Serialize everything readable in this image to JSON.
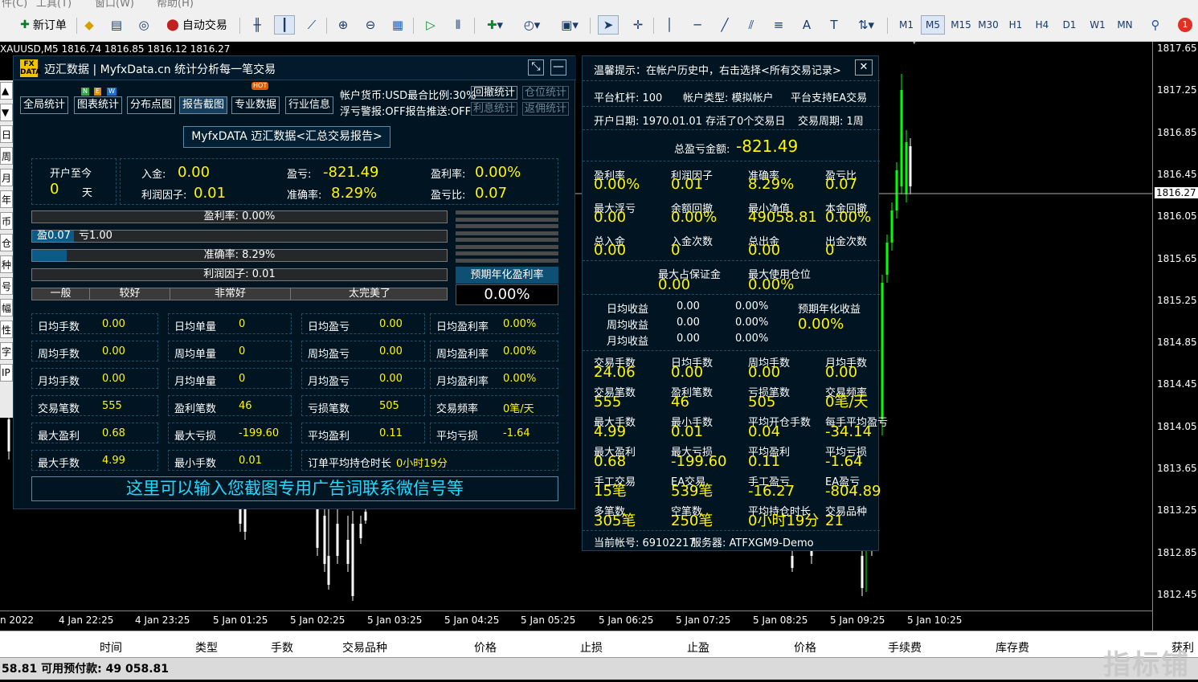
{
  "menu": {
    "items": [
      "件(C)",
      "工具(T)",
      "窗口(W)",
      "帮助(H)"
    ]
  },
  "toolbar": {
    "new_order": "新订单",
    "auto_trade": "自动交易",
    "periods": [
      "M1",
      "M5",
      "M15",
      "M30",
      "H1",
      "H4",
      "D1",
      "W1",
      "MN"
    ],
    "active_period": "M5",
    "notification_count": "1",
    "text_tool": "A"
  },
  "chart": {
    "symbol_line": "XAUUSD,M5  1816.74 1816.85 1816.12 1816.27",
    "current_price": "1816.27",
    "price_ticks": [
      "1817.65",
      "1817.25",
      "1816.85",
      "1816.45",
      "1816.05",
      "1815.65",
      "1815.25",
      "1814.85",
      "1814.45",
      "1814.05",
      "1813.65",
      "1813.25",
      "1812.85",
      "1812.45"
    ],
    "time_ticks": [
      "n 2022",
      "4 Jan 22:25",
      "4 Jan 23:25",
      "5 Jan 01:25",
      "5 Jan 02:25",
      "5 Jan 03:25",
      "5 Jan 04:25",
      "5 Jan 05:25",
      "5 Jan 06:25",
      "5 Jan 07:25",
      "5 Jan 08:25",
      "5 Jan 09:25",
      "5 Jan 10:25"
    ],
    "bull_color": "#00ff00",
    "bear_color": "#ffffff"
  },
  "left_tabs": [
    "▲",
    "▼",
    "日",
    "周",
    "月",
    "年",
    "币",
    "仓",
    "种",
    "号",
    "幅",
    "性",
    "字",
    "IP"
  ],
  "panel": {
    "title": "迈汇数据 | MyfxData.cn  统计分析每一笔交易",
    "logo_top": "FX",
    "logo_bottom": "DATA",
    "nav": [
      "全局统计",
      "图表统计",
      "分布点图",
      "报告截图",
      "专业数据",
      "行业信息"
    ],
    "badges": {
      "n": "N",
      "e": "E",
      "w": "W",
      "hot": "HOT"
    },
    "account_info_1": "帐户货币:USD最合比例:30%",
    "account_info_2": "浮亏警报:OFF报告推送:OFF",
    "btn_drawdown": "回撤统计",
    "btn_position": "仓位统计",
    "btn_interest": "利息统计",
    "btn_rebate": "返佣统计",
    "report_button": "MyfxDATA 迈汇数据<汇总交易报告>",
    "since_open_label": "开户至今",
    "since_open_days": "0",
    "days_unit": "天",
    "deposit_label": "入金:",
    "deposit": "0.00",
    "pl_label": "盈亏:",
    "pl": "-821.49",
    "return_label": "盈利率:",
    "return_rate": "0.00%",
    "profit_factor_label": "利润因子:",
    "profit_factor": "0.01",
    "accuracy_label": "准确率:",
    "accuracy": "8.29%",
    "pl_ratio_label": "盈亏比:",
    "pl_ratio": "0.07",
    "bar_return": "盈利率: 0.00%",
    "bar_pl_win": "盈0.07",
    "bar_pl_loss": "亏1.00",
    "bar_pl_fill": 0.07,
    "bar_accuracy": "准确率: 8.29%",
    "bar_accuracy_fill": 0.0829,
    "bar_pf": "利润因子: 0.01",
    "scale": [
      "一般",
      "较好",
      "非常好",
      "太完美了"
    ],
    "annual_label": "预期年化盈利率",
    "annual_value": "0.00%",
    "stats": [
      [
        {
          "l": "日均手数",
          "v": "0.00"
        },
        {
          "l": "日均单量",
          "v": "0"
        },
        {
          "l": "日均盈亏",
          "v": "0.00"
        },
        {
          "l": "日均盈利率",
          "v": "0.00%"
        }
      ],
      [
        {
          "l": "周均手数",
          "v": "0.00"
        },
        {
          "l": "周均单量",
          "v": "0"
        },
        {
          "l": "周均盈亏",
          "v": "0.00"
        },
        {
          "l": "周均盈利率",
          "v": "0.00%"
        }
      ],
      [
        {
          "l": "月均手数",
          "v": "0.00"
        },
        {
          "l": "月均单量",
          "v": "0"
        },
        {
          "l": "月均盈亏",
          "v": "0.00"
        },
        {
          "l": "月均盈利率",
          "v": "0.00%"
        }
      ],
      [
        {
          "l": "交易笔数",
          "v": "555"
        },
        {
          "l": "盈利笔数",
          "v": "46"
        },
        {
          "l": "亏损笔数",
          "v": "505"
        },
        {
          "l": "交易频率",
          "v": "0笔/天"
        }
      ],
      [
        {
          "l": "最大盈利",
          "v": "0.68"
        },
        {
          "l": "最大亏损",
          "v": "-199.60"
        },
        {
          "l": "平均盈利",
          "v": "0.11"
        },
        {
          "l": "平均亏损",
          "v": "-1.64"
        }
      ]
    ],
    "last_row": [
      {
        "l": "最大手数",
        "v": "4.99"
      },
      {
        "l": "最小手数",
        "v": "0.01"
      }
    ],
    "avg_hold_label": "订单平均持仓时长",
    "avg_hold": "0小时19分",
    "ad_text": "这里可以输入您截图专用广告词联系微信号等"
  },
  "right": {
    "tip": "温馨提示：在帐户历史中，右击选择<所有交易记录>",
    "close": "✕",
    "leverage": "平台杠杆: 100",
    "acct_type": "帐户类型: 模拟帐户",
    "ea_support": "平台支持EA交易",
    "open_date": "开户日期: 1970.01.01 存活了0个交易日",
    "period": "交易周期: 1周",
    "total_pl_label": "总盈亏金额:",
    "total_pl": "-821.49",
    "grid1": [
      [
        {
          "l": "盈利率",
          "v": "0.00%"
        },
        {
          "l": "利润因子",
          "v": "0.01"
        },
        {
          "l": "准确率",
          "v": "8.29%"
        },
        {
          "l": "盈亏比",
          "v": "0.07"
        }
      ],
      [
        {
          "l": "最大浮亏",
          "v": "0.00"
        },
        {
          "l": "余额回撤",
          "v": "0.00%"
        },
        {
          "l": "最小净值",
          "v": "49058.81"
        },
        {
          "l": "本金回撤",
          "v": "0.00%"
        }
      ],
      [
        {
          "l": "总入金",
          "v": "0.00"
        },
        {
          "l": "入金次数",
          "v": "0"
        },
        {
          "l": "总出金",
          "v": "0.00"
        },
        {
          "l": "出金次数",
          "v": "0"
        }
      ]
    ],
    "max_margin_label": "最大占保证金",
    "max_margin": "0.00",
    "max_pos_label": "最大使用仓位",
    "max_pos": "0.00%",
    "income": [
      {
        "l": "日均收益",
        "v": "0.00",
        "p": "0.00%"
      },
      {
        "l": "周均收益",
        "v": "0.00",
        "p": "0.00%"
      },
      {
        "l": "月均收益",
        "v": "0.00",
        "p": "0.00%"
      }
    ],
    "annual_label": "预期年化收益",
    "annual_value": "0.00%",
    "grid2": [
      [
        {
          "l": "交易手数",
          "v": "24.06"
        },
        {
          "l": "日均手数",
          "v": "0.00"
        },
        {
          "l": "周均手数",
          "v": "0.00"
        },
        {
          "l": "月均手数",
          "v": "0.00"
        }
      ],
      [
        {
          "l": "交易笔数",
          "v": "555"
        },
        {
          "l": "盈利笔数",
          "v": "46"
        },
        {
          "l": "亏损笔数",
          "v": "505"
        },
        {
          "l": "交易频率",
          "v": "0笔/天"
        }
      ],
      [
        {
          "l": "最大手数",
          "v": "4.99"
        },
        {
          "l": "最小手数",
          "v": "0.01"
        },
        {
          "l": "平均开仓手数",
          "v": "0.04"
        },
        {
          "l": "每手平均盈亏",
          "v": "-34.14"
        }
      ],
      [
        {
          "l": "最大盈利",
          "v": "0.68"
        },
        {
          "l": "最大亏损",
          "v": "-199.60"
        },
        {
          "l": "平均盈利",
          "v": "0.11"
        },
        {
          "l": "平均亏损",
          "v": "-1.64"
        }
      ],
      [
        {
          "l": "手工交易",
          "v": "15笔"
        },
        {
          "l": "EA交易",
          "v": "539笔"
        },
        {
          "l": "手工盈亏",
          "v": "-16.27"
        },
        {
          "l": "EA盈亏",
          "v": "-804.89"
        }
      ],
      [
        {
          "l": "多笔数",
          "v": "305笔"
        },
        {
          "l": "空笔数",
          "v": "250笔"
        },
        {
          "l": "平均持仓时长",
          "v": "0小时19分"
        },
        {
          "l": "交易品种",
          "v": "21"
        }
      ]
    ],
    "account_line": "当前帐号: 69102217",
    "server_line": "服务器: ATFXGM9-Demo"
  },
  "columns": [
    "时间",
    "类型",
    "手数",
    "交易品种",
    "价格",
    "止损",
    "止盈",
    "价格",
    "手续费",
    "库存费",
    "获利"
  ],
  "status": "58.81  可用预付款: 49 058.81",
  "watermark": "指标铺"
}
